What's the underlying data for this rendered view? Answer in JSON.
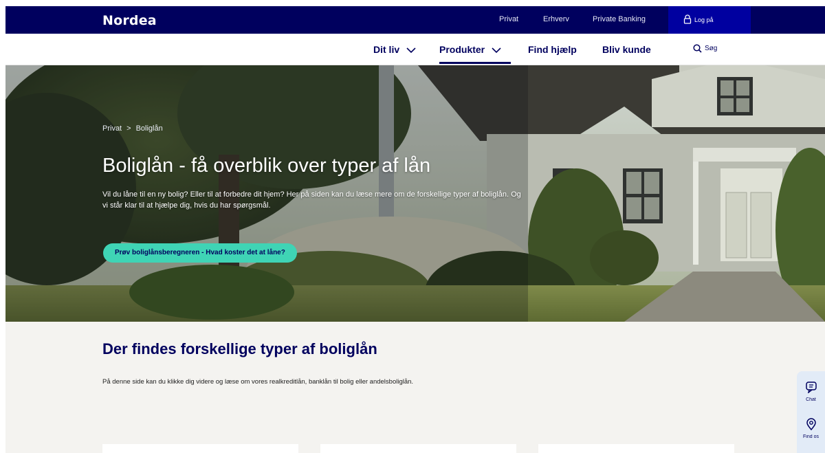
{
  "brand": {
    "logo": "Nordea"
  },
  "top_nav": {
    "links": [
      "Privat",
      "Erhverv",
      "Private Banking"
    ],
    "login_label": "Log på"
  },
  "main_nav": {
    "items": [
      {
        "label": "Dit liv",
        "has_dropdown": true
      },
      {
        "label": "Produkter",
        "has_dropdown": true,
        "active": true
      },
      {
        "label": "Find hjælp",
        "has_dropdown": false
      },
      {
        "label": "Bliv kunde",
        "has_dropdown": false
      }
    ],
    "search_label": "Søg"
  },
  "hero": {
    "breadcrumb": [
      "Privat",
      "Boliglån"
    ],
    "breadcrumb_separator": ">",
    "title": "Boliglån - få overblik over typer af lån",
    "description": "Vil du låne til en ny bolig? Eller til at forbedre dit hjem? Her på siden kan du læse mere om de forskellige typer af boliglån. Og vi står klar til at hjælpe dig, hvis du har spørgsmål.",
    "cta_label": "Prøv boliglånsberegneren - Hvad koster det at låne?"
  },
  "section": {
    "title": "Der findes forskellige typer af boliglån",
    "description": "På denne side kan du klikke dig videre og læse om vores realkreditlån, banklån til bolig eller andelsboliglån."
  },
  "side_widget": {
    "items": [
      {
        "label": "Chat",
        "icon": "chat-icon"
      },
      {
        "label": "Find os",
        "icon": "location-pin-icon"
      }
    ]
  },
  "colors": {
    "brand_navy": "#00005e",
    "login_blue": "#0000a0",
    "cta_teal": "#3fd4b5",
    "section_bg": "#f4f3f0"
  }
}
